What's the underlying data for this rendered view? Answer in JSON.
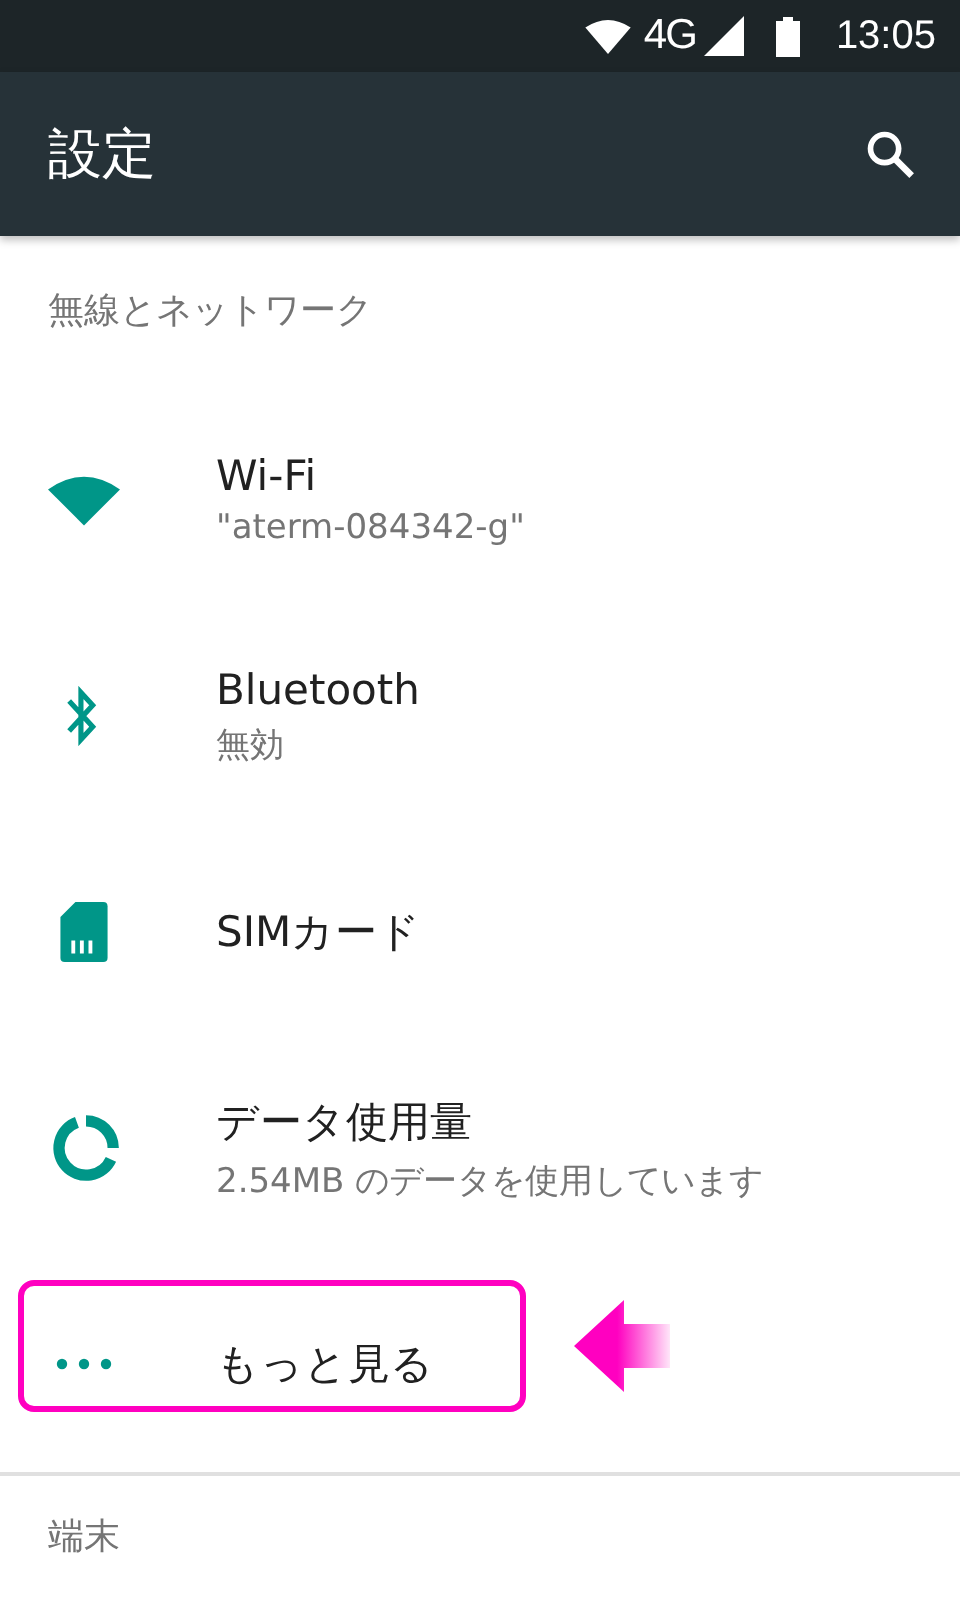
{
  "status_bar": {
    "network": "4G",
    "time": "13:05"
  },
  "app_bar": {
    "title": "設定"
  },
  "sections": [
    {
      "header": "無線とネットワーク",
      "items": [
        {
          "kind": "wifi",
          "title": "Wi-Fi",
          "subtitle": "\"aterm-084342-g\"",
          "highlighted": false
        },
        {
          "kind": "bluetooth",
          "title": "Bluetooth",
          "subtitle": "無効",
          "highlighted": false
        },
        {
          "kind": "sim",
          "title": "SIMカード",
          "highlighted": false
        },
        {
          "kind": "data",
          "title": "データ使用量",
          "subtitle": "2.54MB のデータを使用しています",
          "highlighted": false
        },
        {
          "kind": "more",
          "title": "もっと見る",
          "highlighted": true
        }
      ]
    },
    {
      "header": "端末"
    }
  ]
}
